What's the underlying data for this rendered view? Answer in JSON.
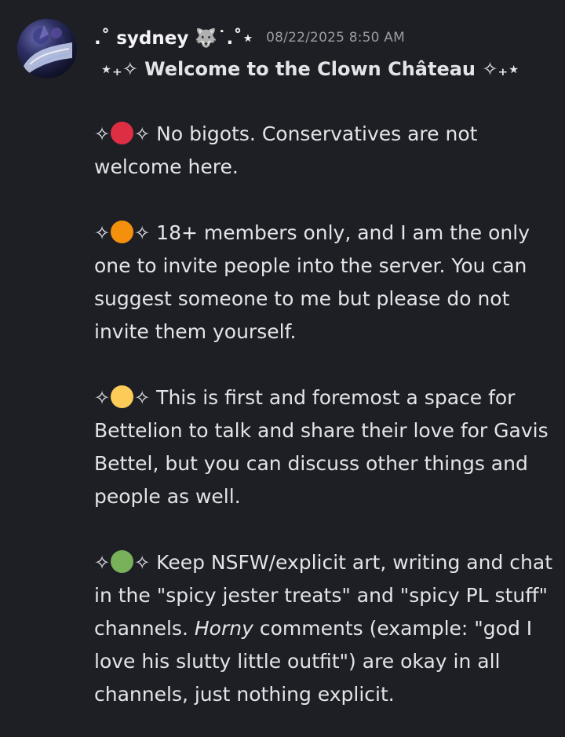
{
  "message": {
    "author": {
      "username": ".˚ sydney 🐺˙.˚⋆",
      "timestamp": "08/22/2025 8:50 AM"
    },
    "title": "⋆₊✧ Welcome to the Clown Château ✧₊⋆",
    "sparkle": "✧",
    "rules": [
      {
        "color": "#dd2e44",
        "text": "No bigots. Conservatives are not welcome here."
      },
      {
        "color": "#f4900c",
        "text": "18+ members only, and I am the only one to invite people into the server. You can suggest someone to me but please do not invite them yourself."
      },
      {
        "color": "#fdcb58",
        "text": "This is first and foremost a space for Bettelion to talk and share their love for Gavis Bettel, but you can discuss other things and people as well."
      },
      {
        "color": "#78b159",
        "text_before": "Keep NSFW/explicit art, writing and chat in the \"spicy jester treats\" and \"spicy PL stuff\" channels.",
        "text_italic": "Horny",
        "text_after": "comments (example: \"god I love his slutty little outfit\") are okay in all channels, just nothing explicit."
      }
    ]
  }
}
